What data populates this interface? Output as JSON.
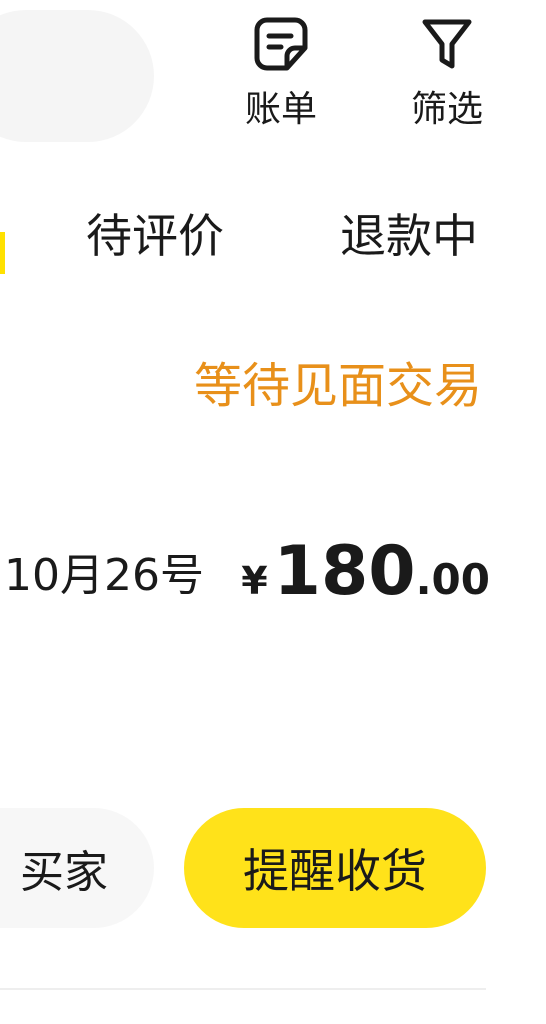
{
  "header": {
    "bill_label": "账单",
    "filter_label": "筛选"
  },
  "tabs": [
    {
      "label": "待评价"
    },
    {
      "label": "退款中"
    }
  ],
  "order": {
    "status": "等待见面交易",
    "date": "10月26号",
    "price": {
      "currency": "¥",
      "integer": "180",
      "decimal": ".00"
    },
    "actions": {
      "contact_label": "买家",
      "remind_label": "提醒收货"
    }
  },
  "colors": {
    "accent_yellow": "#ffe21a",
    "status_orange": "#e8901a"
  }
}
